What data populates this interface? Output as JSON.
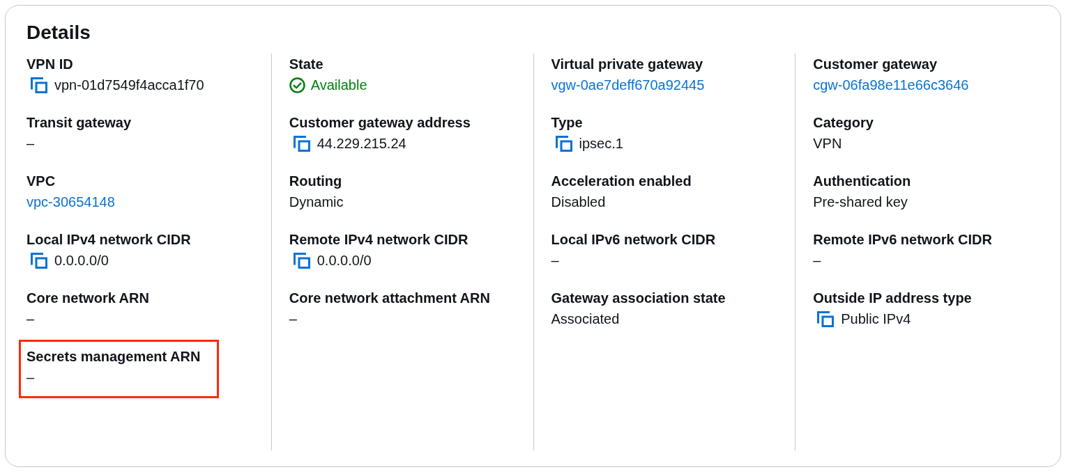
{
  "title": "Details",
  "columns": [
    {
      "items": [
        {
          "label": "VPN ID",
          "kind": "copyable",
          "value": "vpn-01d7549f4acca1f70",
          "highlighted": false
        },
        {
          "label": "Transit gateway",
          "kind": "text",
          "value": "–",
          "highlighted": false
        },
        {
          "label": "VPC",
          "kind": "link",
          "value": "vpc-30654148",
          "highlighted": false
        },
        {
          "label": "Local IPv4 network CIDR",
          "kind": "copyable",
          "value": "0.0.0.0/0",
          "highlighted": false
        },
        {
          "label": "Core network ARN",
          "kind": "text",
          "value": "–",
          "highlighted": false
        },
        {
          "label": "Secrets management ARN",
          "kind": "text",
          "value": "–",
          "highlighted": true
        }
      ]
    },
    {
      "items": [
        {
          "label": "State",
          "kind": "status",
          "color": "#037f0c",
          "value": "Available",
          "highlighted": false
        },
        {
          "label": "Customer gateway address",
          "kind": "copyable",
          "value": "44.229.215.24",
          "highlighted": false
        },
        {
          "label": "Routing",
          "kind": "text",
          "value": "Dynamic",
          "highlighted": false
        },
        {
          "label": "Remote IPv4 network CIDR",
          "kind": "copyable",
          "value": "0.0.0.0/0",
          "highlighted": false
        },
        {
          "label": "Core network attachment ARN",
          "kind": "text",
          "value": "–",
          "highlighted": false
        }
      ]
    },
    {
      "items": [
        {
          "label": "Virtual private gateway",
          "kind": "link",
          "value": "vgw-0ae7deff670a92445",
          "highlighted": false
        },
        {
          "label": "Type",
          "kind": "copyable",
          "value": "ipsec.1",
          "highlighted": false
        },
        {
          "label": "Acceleration enabled",
          "kind": "text",
          "value": "Disabled",
          "highlighted": false
        },
        {
          "label": "Local IPv6 network CIDR",
          "kind": "text",
          "value": "–",
          "highlighted": false
        },
        {
          "label": "Gateway association state",
          "kind": "text",
          "value": "Associated",
          "highlighted": false
        }
      ]
    },
    {
      "items": [
        {
          "label": "Customer gateway",
          "kind": "link",
          "value": "cgw-06fa98e11e66c3646",
          "highlighted": false
        },
        {
          "label": "Category",
          "kind": "text",
          "value": "VPN",
          "highlighted": false
        },
        {
          "label": "Authentication",
          "kind": "text",
          "value": "Pre-shared key",
          "highlighted": false
        },
        {
          "label": "Remote IPv6 network CIDR",
          "kind": "text",
          "value": "–",
          "highlighted": false
        },
        {
          "label": "Outside IP address type",
          "kind": "copyable",
          "value": "Public IPv4",
          "highlighted": false
        }
      ]
    }
  ]
}
